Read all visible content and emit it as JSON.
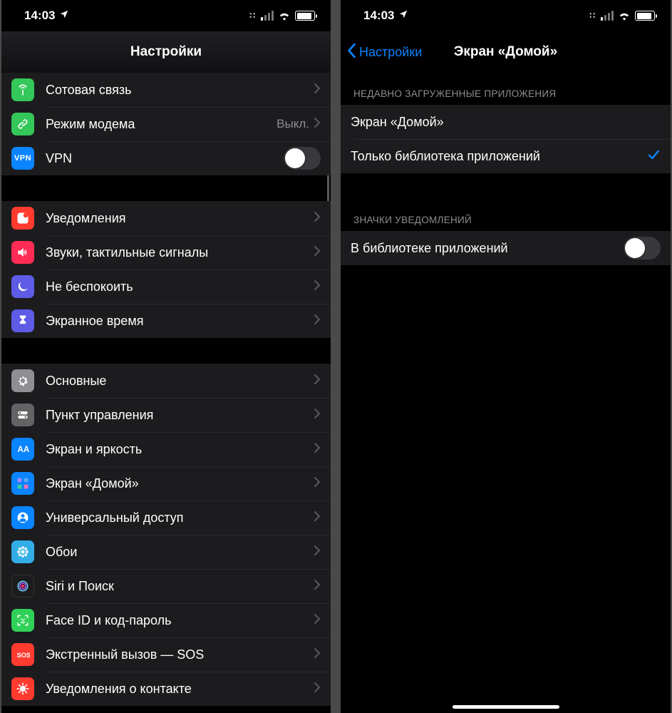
{
  "status": {
    "time": "14:03"
  },
  "left": {
    "title": "Настройки",
    "groups": [
      {
        "rows": [
          {
            "key": "cellular",
            "label": "Сотовая связь",
            "icon": "antenna",
            "iconbg": "bg-green",
            "type": "chevron"
          },
          {
            "key": "hotspot",
            "label": "Режим модема",
            "detail": "Выкл.",
            "icon": "link",
            "iconbg": "bg-green2",
            "type": "chevron"
          },
          {
            "key": "vpn",
            "label": "VPN",
            "icon": "vpn",
            "iconbg": "vpn-box",
            "type": "toggle",
            "on": false
          }
        ]
      },
      {
        "rows": [
          {
            "key": "notifications",
            "label": "Уведомления",
            "icon": "bell-sq",
            "iconbg": "bg-red",
            "type": "chevron"
          },
          {
            "key": "sounds",
            "label": "Звуки, тактильные сигналы",
            "icon": "speaker",
            "iconbg": "bg-pink",
            "type": "chevron"
          },
          {
            "key": "dnd",
            "label": "Не беспокоить",
            "icon": "moon",
            "iconbg": "bg-purple",
            "type": "chevron"
          },
          {
            "key": "screentime",
            "label": "Экранное время",
            "icon": "hourglass",
            "iconbg": "bg-purple",
            "type": "chevron"
          }
        ]
      },
      {
        "rows": [
          {
            "key": "general",
            "label": "Основные",
            "icon": "gear",
            "iconbg": "bg-gray",
            "type": "chevron"
          },
          {
            "key": "controlcenter",
            "label": "Пункт управления",
            "icon": "switches",
            "iconbg": "bg-gray2",
            "type": "chevron"
          },
          {
            "key": "display",
            "label": "Экран и яркость",
            "icon": "aa",
            "iconbg": "bg-blue",
            "type": "chevron"
          },
          {
            "key": "homescreen",
            "label": "Экран «Домой»",
            "icon": "grid",
            "iconbg": "bg-blue",
            "type": "chevron"
          },
          {
            "key": "accessibility",
            "label": "Универсальный доступ",
            "icon": "person",
            "iconbg": "bg-blue",
            "type": "chevron"
          },
          {
            "key": "wallpaper",
            "label": "Обои",
            "icon": "flower",
            "iconbg": "bg-teal",
            "type": "chevron"
          },
          {
            "key": "siri",
            "label": "Siri и Поиск",
            "icon": "siri",
            "iconbg": "bg-dark",
            "type": "chevron"
          },
          {
            "key": "faceid",
            "label": "Face ID и код-пароль",
            "icon": "face",
            "iconbg": "bg-faceid",
            "type": "chevron"
          },
          {
            "key": "sos",
            "label": "Экстренный вызов — SOS",
            "icon": "sos",
            "iconbg": "bg-sos",
            "type": "chevron"
          },
          {
            "key": "exposure",
            "label": "Уведомления о контакте",
            "icon": "covid",
            "iconbg": "bg-redgrid",
            "type": "chevron"
          }
        ]
      }
    ]
  },
  "right": {
    "back": "Настройки",
    "title": "Экран «Домой»",
    "groups": [
      {
        "header": "НЕДАВНО ЗАГРУЖЕННЫЕ ПРИЛОЖЕНИЯ",
        "rows": [
          {
            "key": "addhome",
            "label": "Экран «Домой»",
            "type": "radio",
            "selected": false
          },
          {
            "key": "libonly",
            "label": "Только библиотека приложений",
            "type": "radio",
            "selected": true
          }
        ]
      },
      {
        "header": "ЗНАЧКИ УВЕДОМЛЕНИЙ",
        "rows": [
          {
            "key": "libbadges",
            "label": "В библиотеке приложений",
            "type": "toggle",
            "on": false
          }
        ]
      }
    ]
  }
}
